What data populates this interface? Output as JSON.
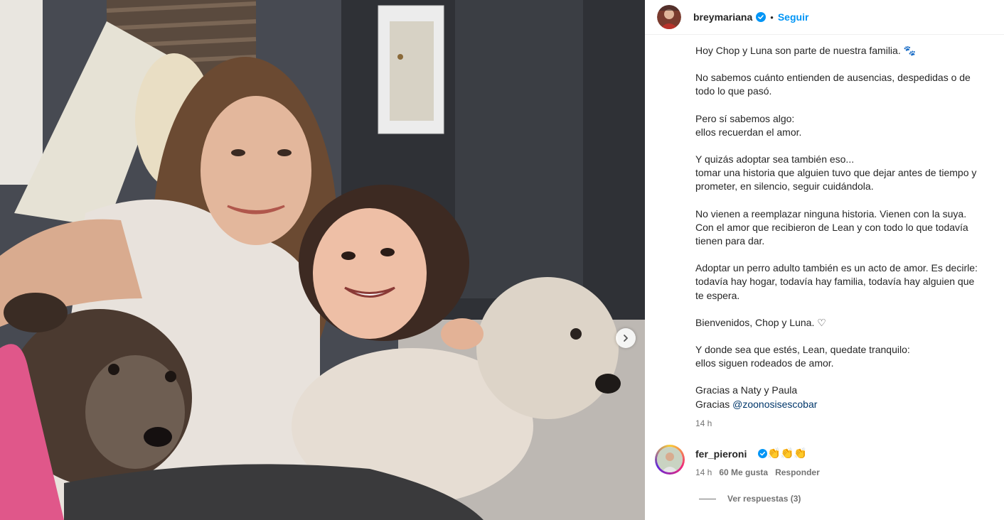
{
  "post": {
    "username": "breymariana",
    "follow_label": "Seguir",
    "separator": "•"
  },
  "caption": {
    "p1": "Hoy Chop y Luna son parte de nuestra familia. 🐾",
    "p2_l1": "No sabemos cuánto entienden de ausencias, despedidas o de",
    "p2_l2": "todo lo que pasó.",
    "p3_l1": "Pero sí sabemos algo:",
    "p3_l2": "ellos recuerdan el amor.",
    "p4_l1": "Y quizás adoptar sea también eso...",
    "p4_l2": "tomar una historia que alguien tuvo que dejar antes de tiempo y",
    "p4_l3": "prometer, en silencio, seguir cuidándola.",
    "p5_l1": "No vienen a reemplazar ninguna historia. Vienen con la suya.",
    "p5_l2": "Con el amor que recibieron de Lean y con todo lo que todavía",
    "p5_l3": "tienen para dar.",
    "p6_l1": "Adoptar un perro adulto también es un acto de amor. Es decirle:",
    "p6_l2": "todavía hay hogar, todavía hay familia, todavía hay alguien que",
    "p6_l3": "te espera.",
    "p7": "Bienvenidos, Chop y Luna. ♡",
    "p8_l1": "Y donde sea que estés, Lean, quedate tranquilo:",
    "p8_l2": "ellos siguen rodeados de amor.",
    "p9_l1": "Gracias a Naty y Paula",
    "p9_l2_prefix": "Gracias ",
    "p9_mention": "@zoonosisescobar"
  },
  "timestamp": "14 h",
  "comment": {
    "username": "fer_pieroni",
    "text": "👏👏👏",
    "time": "14 h",
    "likes": "60 Me gusta",
    "reply_label": "Responder",
    "view_replies": "Ver respuestas (3)"
  },
  "colors": {
    "link": "#0095f6",
    "mention": "#00376b",
    "verified": "#0095f6",
    "meta": "#737373"
  },
  "icons": {
    "verified": "verified-badge-icon",
    "next": "chevron-right-icon"
  }
}
